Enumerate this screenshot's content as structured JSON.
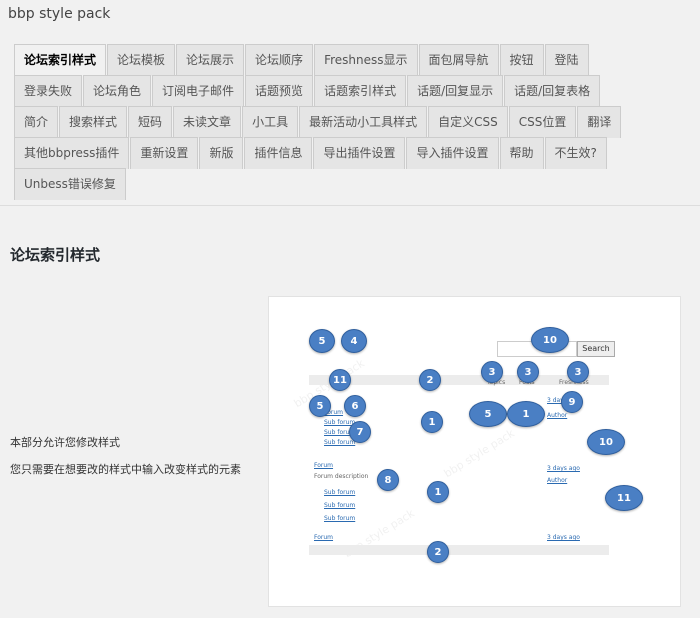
{
  "app_title": "bbp style pack",
  "tabs_rows": [
    [
      "论坛索引样式",
      "论坛模板",
      "论坛展示",
      "论坛顺序",
      "Freshness显示",
      "面包屑导航",
      "按钮",
      "登陆"
    ],
    [
      "登录失败",
      "论坛角色",
      "订阅电子邮件",
      "话题预览",
      "话题索引样式",
      "话题/回复显示",
      "话题/回复表格"
    ],
    [
      "简介",
      "搜索样式",
      "短码",
      "未读文章",
      "小工具",
      "最新活动小工具样式",
      "自定义CSS",
      "CSS位置",
      "翻译"
    ],
    [
      "其他bbpress插件",
      "重新设置",
      "新版",
      "插件信息",
      "导出插件设置",
      "导入插件设置",
      "帮助",
      "不生效?"
    ],
    [
      "Unbess错误修复"
    ]
  ],
  "active_tab": "论坛索引样式",
  "section": {
    "title": "论坛索引样式",
    "desc_1": "本部分允许您修改样式",
    "desc_2": "您只需要在想要改的样式中输入改变样式的元素"
  },
  "preview": {
    "search_label": "Search",
    "bubbles": [
      "5",
      "4",
      "10",
      "3",
      "3",
      "3",
      "11",
      "2",
      "5",
      "6",
      "1",
      "7",
      "5",
      "1",
      "9",
      "10",
      "8",
      "1",
      "11",
      "2"
    ]
  }
}
